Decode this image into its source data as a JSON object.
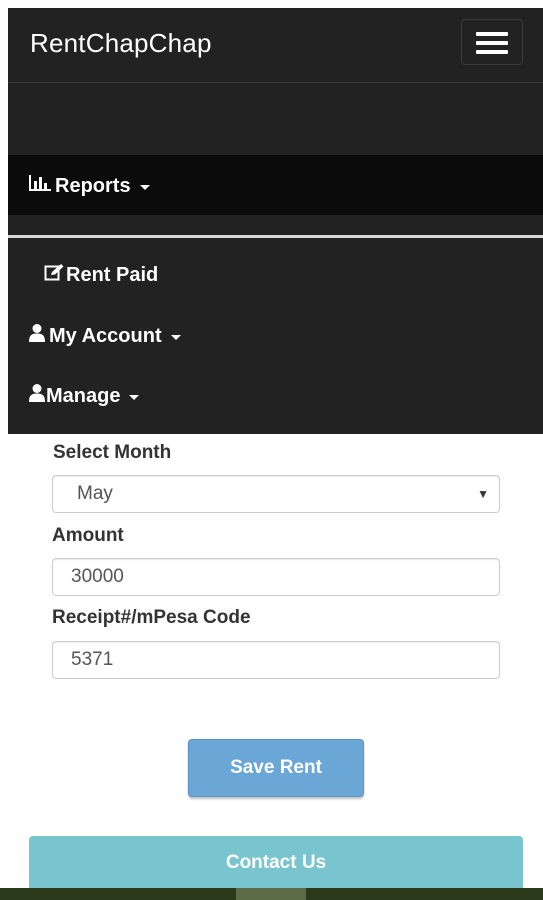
{
  "app": {
    "brand": "RentChapChap"
  },
  "nav": {
    "reports_label": "Reports",
    "rent_paid_label": "Rent Paid",
    "my_account_label": "My Account",
    "manage_label": "Manage"
  },
  "form": {
    "month_label": "Select Month",
    "month_value": "May",
    "amount_label": "Amount",
    "amount_value": "30000",
    "receipt_label": "Receipt#/mPesa Code",
    "receipt_value": "5371",
    "save_label": "Save Rent"
  },
  "footer": {
    "contact_label": "Contact Us"
  },
  "icons": {
    "reports": "bar-chart-icon",
    "rent_paid": "edit-icon",
    "my_account": "user-icon",
    "manage": "users-icon",
    "menu_toggle": "hamburger-icon",
    "select_caret": "chevron-down-icon"
  },
  "colors": {
    "navbar_bg": "#222222",
    "active_row_bg": "#0b0b0b",
    "save_button": "#6aa6d6",
    "contact_button": "#79c5cf"
  }
}
